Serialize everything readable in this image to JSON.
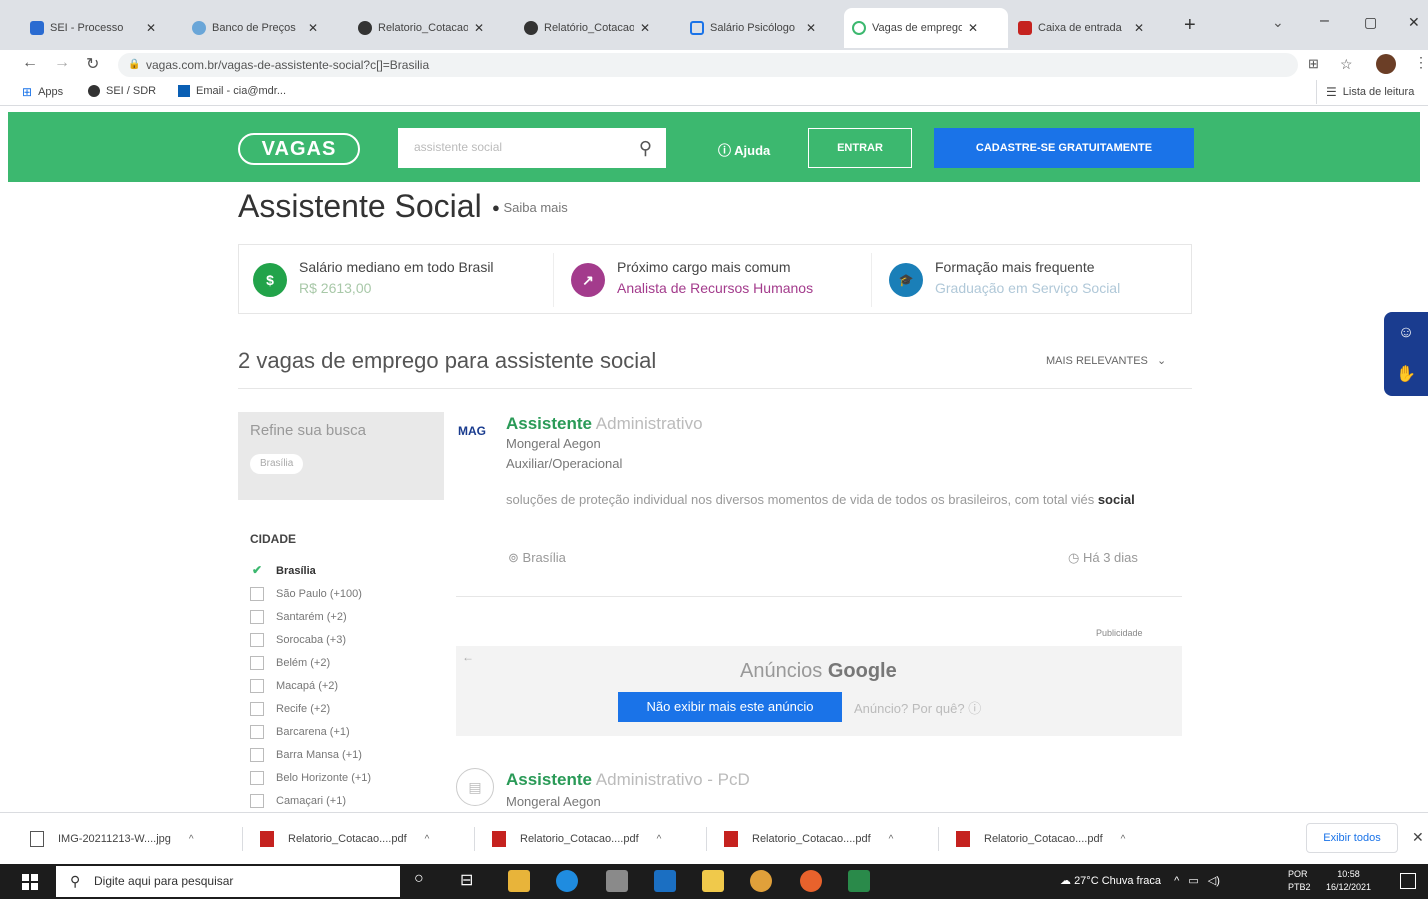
{
  "browser": {
    "tabs": [
      {
        "label": "SEI - Processo",
        "color": "#2a6bd1"
      },
      {
        "label": "Banco de Preços",
        "color": "#6aa6d8"
      },
      {
        "label": "Relatorio_Cotacao",
        "color": "#333333"
      },
      {
        "label": "Relatório_Cotacao",
        "color": "#333333"
      },
      {
        "label": "Salário Psicólogo",
        "color": "#1a73e8"
      },
      {
        "label": "Vagas de emprego",
        "color": "#3cb86f"
      },
      {
        "label": "Caixa de entrada",
        "color": "#c5221f"
      }
    ],
    "new_tab": "+",
    "window_controls": {
      "chevron": "⌄",
      "minimize": "–",
      "maximize": "▢",
      "close": "✕"
    },
    "url": "vagas.com.br/vagas-de-assistente-social?c[]=Brasilia",
    "bookmarks": [
      {
        "label": "Apps",
        "icon": "apps-grid-icon"
      },
      {
        "label": "SEI / SDR",
        "icon": "globe-icon"
      },
      {
        "label": "Email - cia@mdr...",
        "icon": "outlook-icon"
      }
    ],
    "reading_list": "Lista de leitura"
  },
  "site": {
    "logo": "VAGAS",
    "search_placeholder": "assistente social",
    "help": "Ajuda",
    "login": "ENTRAR",
    "signup": "CADASTRE-SE GRATUITAMENTE",
    "colors": {
      "brand_green": "#3cb86f",
      "brand_blue": "#1a73e8",
      "brand_navy": "#1a3c8f"
    }
  },
  "page": {
    "title": "Assistente Social",
    "saiba_mais": "Saiba mais",
    "info": [
      {
        "title": "Salário mediano em todo Brasil",
        "value": "R$ 2613,00",
        "color": "#22a34a",
        "value_color": "#a8c8a8",
        "icon": "$"
      },
      {
        "title": "Próximo cargo mais comum",
        "value": "Analista de Recursos Humanos",
        "color": "#a33b8c",
        "value_color": "#a33b8c",
        "icon": "↗"
      },
      {
        "title": "Formação mais frequente",
        "value": "Graduação em Serviço Social",
        "color": "#1a7fb8",
        "value_color": "#b0c8d8",
        "icon": "🎓"
      }
    ],
    "results_count": "2 vagas de emprego para assistente social",
    "sort": "MAIS RELEVANTES"
  },
  "sidebar": {
    "refine_title": "Refine sua busca",
    "active_filter": "Brasília",
    "city_header": "CIDADE",
    "cities": [
      {
        "label": "Brasília",
        "checked": true
      },
      {
        "label": "São Paulo (+100)"
      },
      {
        "label": "Santarém (+2)"
      },
      {
        "label": "Sorocaba (+3)"
      },
      {
        "label": "Belém (+2)"
      },
      {
        "label": "Macapá (+2)"
      },
      {
        "label": "Recife (+2)"
      },
      {
        "label": "Barcarena (+1)"
      },
      {
        "label": "Barra Mansa (+1)"
      },
      {
        "label": "Belo Horizonte (+1)"
      },
      {
        "label": "Camaçari (+1)"
      }
    ]
  },
  "jobs": [
    {
      "logo": "MAG",
      "title_strong": "Assistente",
      "title_light": "Administrativo",
      "company": "Mongeral Aegon",
      "level": "Auxiliar/Operacional",
      "desc": "soluções de proteção individual nos diversos momentos de vida de todos os brasileiros, com total viés",
      "desc_bold": "social",
      "location": "Brasília",
      "date": "Há 3 dias"
    },
    {
      "title_strong": "Assistente",
      "title_light": "Administrativo - PcD",
      "company": "Mongeral Aegon"
    }
  ],
  "ad": {
    "label": "Publicidade",
    "title_prefix": "Anúncios",
    "title_brand": "Google",
    "stop_button": "Não exibir mais este anúncio",
    "why": "Anúncio? Por quê?"
  },
  "downloads": {
    "items": [
      {
        "label": "IMG-20211213-W....jpg",
        "color": "#555555"
      },
      {
        "label": "Relatorio_Cotacao....pdf",
        "color": "#c5221f"
      },
      {
        "label": "Relatorio_Cotacao....pdf",
        "color": "#c5221f"
      },
      {
        "label": "Relatorio_Cotacao....pdf",
        "color": "#c5221f"
      },
      {
        "label": "Relatorio_Cotacao....pdf",
        "color": "#c5221f"
      }
    ],
    "show_all": "Exibir todos"
  },
  "taskbar": {
    "search_placeholder": "Digite aqui para pesquisar",
    "weather": "27°C Chuva fraca",
    "lang": [
      "POR",
      "PTB2"
    ],
    "time": "10:58",
    "date": "16/12/2021"
  }
}
